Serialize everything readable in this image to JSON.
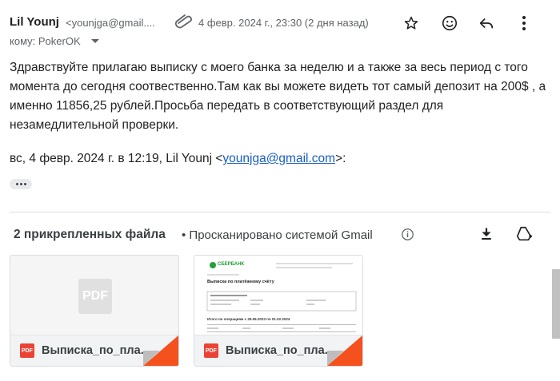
{
  "header": {
    "sender_name": "Lil Younj",
    "sender_email": "<younjga@gmail....",
    "date": "4 февр. 2024 г., 23:30 (2 дня назад)",
    "icons": [
      "paperclip-icon",
      "star-icon",
      "emoji-icon",
      "reply-icon",
      "more-vert-icon"
    ]
  },
  "recipient": {
    "label": "кому: PokerOK"
  },
  "message": {
    "body": "Здравствуйте прилагаю выписку с моего банка за неделю и а также за весь период с того момента до сегодня соотвественно.Там как вы можете видеть тот самый депозит на 200$ , а именно 11856,25 рублей.Просьба передать в соответствующий раздел для незамедлительной проверки.",
    "quote_prefix": "вс, 4 февр. 2024 г. в 12:19, Lil Younj <",
    "quote_email": "younjga@gmail.com",
    "quote_suffix": ">:"
  },
  "attachments": {
    "count_label": "2 прикрепленных файла",
    "scan_label": "• Просканировано системой Gmail",
    "files": [
      {
        "name": "Выписка_по_пла...",
        "type_badge": "PDF",
        "placeholder": "PDF"
      },
      {
        "name": "Выписка_по_пла...",
        "type_badge": "PDF",
        "preview": {
          "bank": "СБЕРБАНК",
          "title": "Выписка по платёжному счёту",
          "period_line": "Итого по операциям с 29.06.2023 по 01.02.2024"
        }
      }
    ]
  },
  "colors": {
    "accent": "#1a5ec4",
    "pdf_red": "#ea4335",
    "fold_orange": "#f4511e",
    "sber_green": "#21a038"
  }
}
